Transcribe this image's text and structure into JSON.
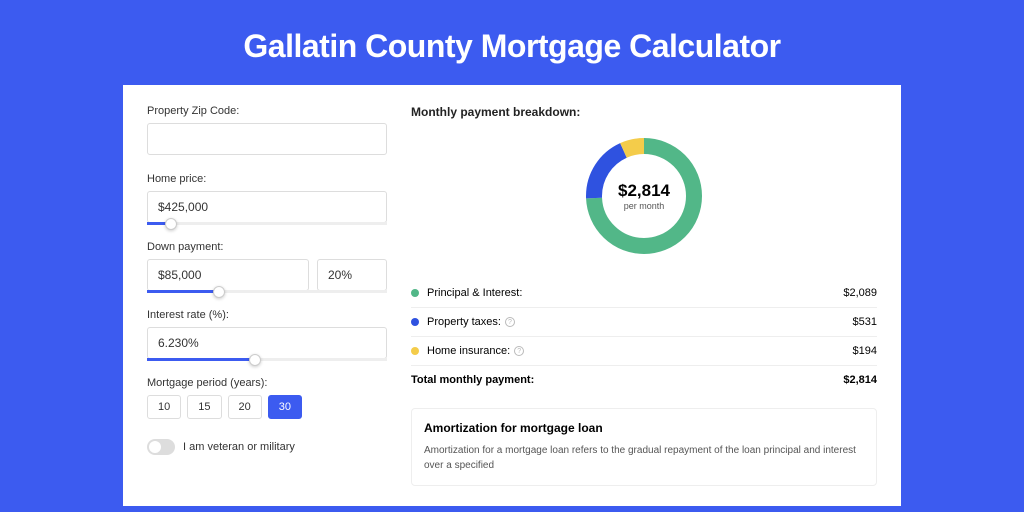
{
  "title": "Gallatin County Mortgage Calculator",
  "form": {
    "zip_label": "Property Zip Code:",
    "zip_value": "",
    "homeprice_label": "Home price:",
    "homeprice_value": "$425,000",
    "homeprice_slider_pct": 10,
    "down_label": "Down payment:",
    "down_value": "$85,000",
    "down_pct_value": "20%",
    "down_slider_pct": 30,
    "rate_label": "Interest rate (%):",
    "rate_value": "6.230%",
    "rate_slider_pct": 45,
    "period_label": "Mortgage period (years):",
    "periods": [
      "10",
      "15",
      "20",
      "30"
    ],
    "period_active_idx": 3,
    "veteran_label": "I am veteran or military"
  },
  "breakdown": {
    "title": "Monthly payment breakdown:",
    "center_value": "$2,814",
    "center_sub": "per month",
    "items": [
      {
        "label": "Principal & Interest:",
        "value": "$2,089",
        "color": "#52b788",
        "pct": 74.2,
        "info": false
      },
      {
        "label": "Property taxes:",
        "value": "$531",
        "color": "#2f52e0",
        "pct": 18.9,
        "info": true
      },
      {
        "label": "Home insurance:",
        "value": "$194",
        "color": "#f4cc4a",
        "pct": 6.9,
        "info": true
      }
    ],
    "total_label": "Total monthly payment:",
    "total_value": "$2,814"
  },
  "amort": {
    "title": "Amortization for mortgage loan",
    "text": "Amortization for a mortgage loan refers to the gradual repayment of the loan principal and interest over a specified"
  },
  "colors": {
    "accent": "#3c5bf0"
  },
  "chart_data": {
    "type": "pie",
    "title": "Monthly payment breakdown",
    "series": [
      {
        "name": "Principal & Interest",
        "value": 2089
      },
      {
        "name": "Property taxes",
        "value": 531
      },
      {
        "name": "Home insurance",
        "value": 194
      }
    ],
    "total": 2814,
    "unit": "USD per month"
  }
}
